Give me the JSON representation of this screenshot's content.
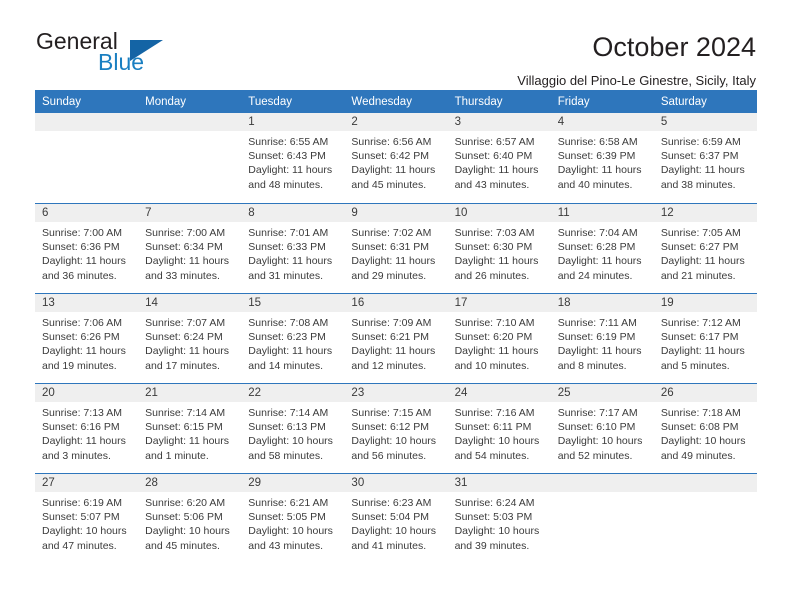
{
  "logo": {
    "word_top": "General",
    "word_bottom": "Blue",
    "triangle_icon": "blue-triangle-icon",
    "accent_color": "#1464a5"
  },
  "header": {
    "title": "October 2024",
    "subtitle": "Villaggio del Pino-Le Ginestre, Sicily, Italy"
  },
  "theme": {
    "header_blue": "#2e76bc",
    "band_gray": "#efefef",
    "text": "#3b3b3b"
  },
  "weekday_headers": [
    "Sunday",
    "Monday",
    "Tuesday",
    "Wednesday",
    "Thursday",
    "Friday",
    "Saturday"
  ],
  "weeks": [
    [
      {
        "day": "",
        "empty": true,
        "sunrise": "",
        "sunset": "",
        "daylight_1": "",
        "daylight_2": ""
      },
      {
        "day": "",
        "empty": true,
        "sunrise": "",
        "sunset": "",
        "daylight_1": "",
        "daylight_2": ""
      },
      {
        "day": "1",
        "sunrise": "Sunrise: 6:55 AM",
        "sunset": "Sunset: 6:43 PM",
        "daylight_1": "Daylight: 11 hours",
        "daylight_2": "and 48 minutes."
      },
      {
        "day": "2",
        "sunrise": "Sunrise: 6:56 AM",
        "sunset": "Sunset: 6:42 PM",
        "daylight_1": "Daylight: 11 hours",
        "daylight_2": "and 45 minutes."
      },
      {
        "day": "3",
        "sunrise": "Sunrise: 6:57 AM",
        "sunset": "Sunset: 6:40 PM",
        "daylight_1": "Daylight: 11 hours",
        "daylight_2": "and 43 minutes."
      },
      {
        "day": "4",
        "sunrise": "Sunrise: 6:58 AM",
        "sunset": "Sunset: 6:39 PM",
        "daylight_1": "Daylight: 11 hours",
        "daylight_2": "and 40 minutes."
      },
      {
        "day": "5",
        "sunrise": "Sunrise: 6:59 AM",
        "sunset": "Sunset: 6:37 PM",
        "daylight_1": "Daylight: 11 hours",
        "daylight_2": "and 38 minutes."
      }
    ],
    [
      {
        "day": "6",
        "sunrise": "Sunrise: 7:00 AM",
        "sunset": "Sunset: 6:36 PM",
        "daylight_1": "Daylight: 11 hours",
        "daylight_2": "and 36 minutes."
      },
      {
        "day": "7",
        "sunrise": "Sunrise: 7:00 AM",
        "sunset": "Sunset: 6:34 PM",
        "daylight_1": "Daylight: 11 hours",
        "daylight_2": "and 33 minutes."
      },
      {
        "day": "8",
        "sunrise": "Sunrise: 7:01 AM",
        "sunset": "Sunset: 6:33 PM",
        "daylight_1": "Daylight: 11 hours",
        "daylight_2": "and 31 minutes."
      },
      {
        "day": "9",
        "sunrise": "Sunrise: 7:02 AM",
        "sunset": "Sunset: 6:31 PM",
        "daylight_1": "Daylight: 11 hours",
        "daylight_2": "and 29 minutes."
      },
      {
        "day": "10",
        "sunrise": "Sunrise: 7:03 AM",
        "sunset": "Sunset: 6:30 PM",
        "daylight_1": "Daylight: 11 hours",
        "daylight_2": "and 26 minutes."
      },
      {
        "day": "11",
        "sunrise": "Sunrise: 7:04 AM",
        "sunset": "Sunset: 6:28 PM",
        "daylight_1": "Daylight: 11 hours",
        "daylight_2": "and 24 minutes."
      },
      {
        "day": "12",
        "sunrise": "Sunrise: 7:05 AM",
        "sunset": "Sunset: 6:27 PM",
        "daylight_1": "Daylight: 11 hours",
        "daylight_2": "and 21 minutes."
      }
    ],
    [
      {
        "day": "13",
        "sunrise": "Sunrise: 7:06 AM",
        "sunset": "Sunset: 6:26 PM",
        "daylight_1": "Daylight: 11 hours",
        "daylight_2": "and 19 minutes."
      },
      {
        "day": "14",
        "sunrise": "Sunrise: 7:07 AM",
        "sunset": "Sunset: 6:24 PM",
        "daylight_1": "Daylight: 11 hours",
        "daylight_2": "and 17 minutes."
      },
      {
        "day": "15",
        "sunrise": "Sunrise: 7:08 AM",
        "sunset": "Sunset: 6:23 PM",
        "daylight_1": "Daylight: 11 hours",
        "daylight_2": "and 14 minutes."
      },
      {
        "day": "16",
        "sunrise": "Sunrise: 7:09 AM",
        "sunset": "Sunset: 6:21 PM",
        "daylight_1": "Daylight: 11 hours",
        "daylight_2": "and 12 minutes."
      },
      {
        "day": "17",
        "sunrise": "Sunrise: 7:10 AM",
        "sunset": "Sunset: 6:20 PM",
        "daylight_1": "Daylight: 11 hours",
        "daylight_2": "and 10 minutes."
      },
      {
        "day": "18",
        "sunrise": "Sunrise: 7:11 AM",
        "sunset": "Sunset: 6:19 PM",
        "daylight_1": "Daylight: 11 hours",
        "daylight_2": "and 8 minutes."
      },
      {
        "day": "19",
        "sunrise": "Sunrise: 7:12 AM",
        "sunset": "Sunset: 6:17 PM",
        "daylight_1": "Daylight: 11 hours",
        "daylight_2": "and 5 minutes."
      }
    ],
    [
      {
        "day": "20",
        "sunrise": "Sunrise: 7:13 AM",
        "sunset": "Sunset: 6:16 PM",
        "daylight_1": "Daylight: 11 hours",
        "daylight_2": "and 3 minutes."
      },
      {
        "day": "21",
        "sunrise": "Sunrise: 7:14 AM",
        "sunset": "Sunset: 6:15 PM",
        "daylight_1": "Daylight: 11 hours",
        "daylight_2": "and 1 minute."
      },
      {
        "day": "22",
        "sunrise": "Sunrise: 7:14 AM",
        "sunset": "Sunset: 6:13 PM",
        "daylight_1": "Daylight: 10 hours",
        "daylight_2": "and 58 minutes."
      },
      {
        "day": "23",
        "sunrise": "Sunrise: 7:15 AM",
        "sunset": "Sunset: 6:12 PM",
        "daylight_1": "Daylight: 10 hours",
        "daylight_2": "and 56 minutes."
      },
      {
        "day": "24",
        "sunrise": "Sunrise: 7:16 AM",
        "sunset": "Sunset: 6:11 PM",
        "daylight_1": "Daylight: 10 hours",
        "daylight_2": "and 54 minutes."
      },
      {
        "day": "25",
        "sunrise": "Sunrise: 7:17 AM",
        "sunset": "Sunset: 6:10 PM",
        "daylight_1": "Daylight: 10 hours",
        "daylight_2": "and 52 minutes."
      },
      {
        "day": "26",
        "sunrise": "Sunrise: 7:18 AM",
        "sunset": "Sunset: 6:08 PM",
        "daylight_1": "Daylight: 10 hours",
        "daylight_2": "and 49 minutes."
      }
    ],
    [
      {
        "day": "27",
        "sunrise": "Sunrise: 6:19 AM",
        "sunset": "Sunset: 5:07 PM",
        "daylight_1": "Daylight: 10 hours",
        "daylight_2": "and 47 minutes."
      },
      {
        "day": "28",
        "sunrise": "Sunrise: 6:20 AM",
        "sunset": "Sunset: 5:06 PM",
        "daylight_1": "Daylight: 10 hours",
        "daylight_2": "and 45 minutes."
      },
      {
        "day": "29",
        "sunrise": "Sunrise: 6:21 AM",
        "sunset": "Sunset: 5:05 PM",
        "daylight_1": "Daylight: 10 hours",
        "daylight_2": "and 43 minutes."
      },
      {
        "day": "30",
        "sunrise": "Sunrise: 6:23 AM",
        "sunset": "Sunset: 5:04 PM",
        "daylight_1": "Daylight: 10 hours",
        "daylight_2": "and 41 minutes."
      },
      {
        "day": "31",
        "sunrise": "Sunrise: 6:24 AM",
        "sunset": "Sunset: 5:03 PM",
        "daylight_1": "Daylight: 10 hours",
        "daylight_2": "and 39 minutes."
      },
      {
        "day": "",
        "empty": true,
        "sunrise": "",
        "sunset": "",
        "daylight_1": "",
        "daylight_2": ""
      },
      {
        "day": "",
        "empty": true,
        "sunrise": "",
        "sunset": "",
        "daylight_1": "",
        "daylight_2": ""
      }
    ]
  ]
}
